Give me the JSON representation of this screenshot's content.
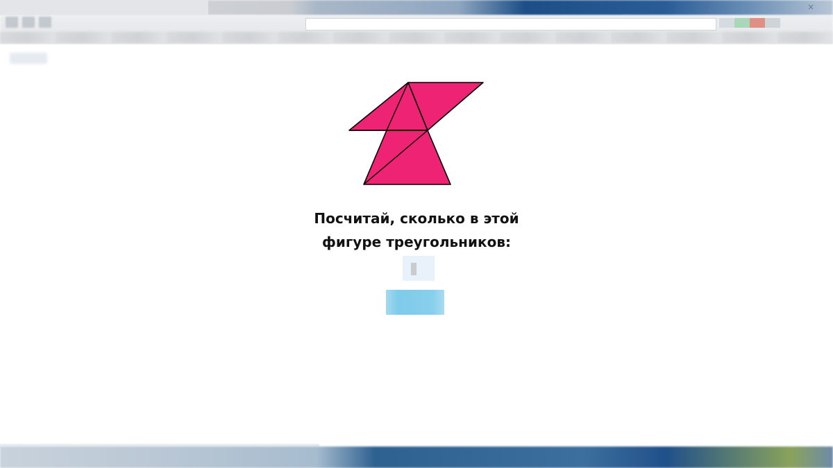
{
  "browser": {
    "close_glyph": "×",
    "accent_color": "#2a5d96"
  },
  "page": {
    "figure": {
      "fill_color": "#ef2373",
      "stroke_color": "#000000"
    },
    "question": {
      "line1": "Посчитай, сколько в этой",
      "line2": "фигуре треугольников:"
    },
    "answer_input": {
      "value": "",
      "placeholder": ""
    },
    "check_button": {
      "label": ""
    }
  }
}
